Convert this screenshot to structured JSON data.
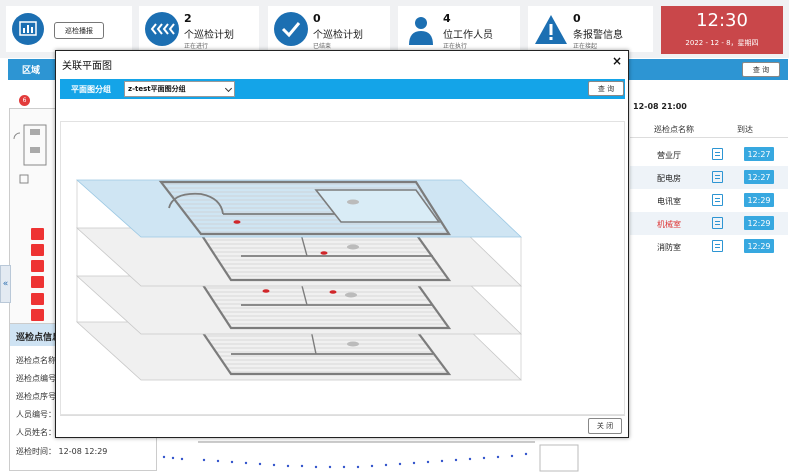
{
  "brand": {
    "button_label": "巡检播报"
  },
  "stats": [
    {
      "number": "2",
      "label": "个巡检计划",
      "sub": "正在进行",
      "icon": "chevron-icon"
    },
    {
      "number": "0",
      "label": "个巡检计划",
      "sub": "已结束",
      "icon": "check-icon"
    },
    {
      "number": "4",
      "label": "位工作人员",
      "sub": "正在执行",
      "icon": "person-icon"
    },
    {
      "number": "0",
      "label": "条报警信息",
      "sub": "正在接起",
      "icon": "warning-icon"
    }
  ],
  "clock": {
    "time": "12:30",
    "date": "2022 - 12 - 8，星期四"
  },
  "tabbar": {
    "area_label": "区域",
    "query_label": "查 询"
  },
  "badge": {
    "count": "6"
  },
  "info_panel": {
    "title": "巡检点信息",
    "rows": [
      "巡检点名称：",
      "巡检点编号：",
      "巡检点序号：",
      "人员编号：",
      "人员姓名：",
      "巡检时间：  12-08 12:29"
    ]
  },
  "right_panel": {
    "date": "12-08 21:00",
    "col_name": "巡检点名称",
    "col_arrive": "到达",
    "rows": [
      {
        "name": "营业厅",
        "time": "12:27",
        "alarm": false
      },
      {
        "name": "配电房",
        "time": "12:27",
        "alarm": false
      },
      {
        "name": "电讯室",
        "time": "12:29",
        "alarm": false
      },
      {
        "name": "机械室",
        "time": "12:29",
        "alarm": true
      },
      {
        "name": "消防室",
        "time": "12:29",
        "alarm": false
      }
    ]
  },
  "modal": {
    "title": "关联平面图",
    "close_symbol": "×",
    "group_label": "平面图分组",
    "selected_group": "z-test平面图分组",
    "query_label": "查 询",
    "close_label": "关 闭"
  },
  "colors": {
    "accent": "#14a4e8",
    "brand": "#1c6fb2",
    "clock_bg": "#c9474a",
    "alarm": "#e23b3b"
  }
}
